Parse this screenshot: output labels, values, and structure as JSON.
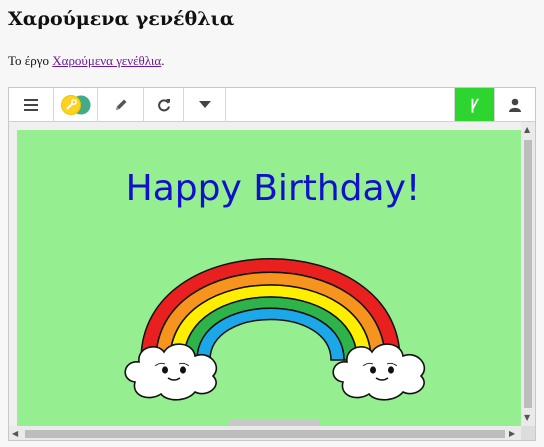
{
  "page": {
    "title": "Χαρούμενα γενέθλια",
    "intro_prefix": "Το έργο ",
    "intro_link": "Χαρούμενα γενέθλια",
    "intro_suffix": "."
  },
  "toolbar": {
    "buttons": [
      {
        "name": "menu",
        "icon": "hamburger-icon"
      },
      {
        "name": "python-logo",
        "icon": "python-logo-icon"
      },
      {
        "name": "edit",
        "icon": "pencil-icon"
      },
      {
        "name": "restart",
        "icon": "refresh-icon"
      },
      {
        "name": "more",
        "icon": "caret-down-icon"
      },
      {
        "name": "interpreter",
        "icon": "python-symbol-icon",
        "glyph": "Ꝩ",
        "color": "#2ed52e"
      },
      {
        "name": "user",
        "icon": "user-icon"
      }
    ]
  },
  "canvas": {
    "background": "#95ee8f",
    "greeting": "Happy Birthday!",
    "greeting_color": "#1111cc",
    "rainbow_colors": [
      "#e8201f",
      "#f7941d",
      "#ffee00",
      "#2db34a",
      "#1ba7e8"
    ]
  }
}
